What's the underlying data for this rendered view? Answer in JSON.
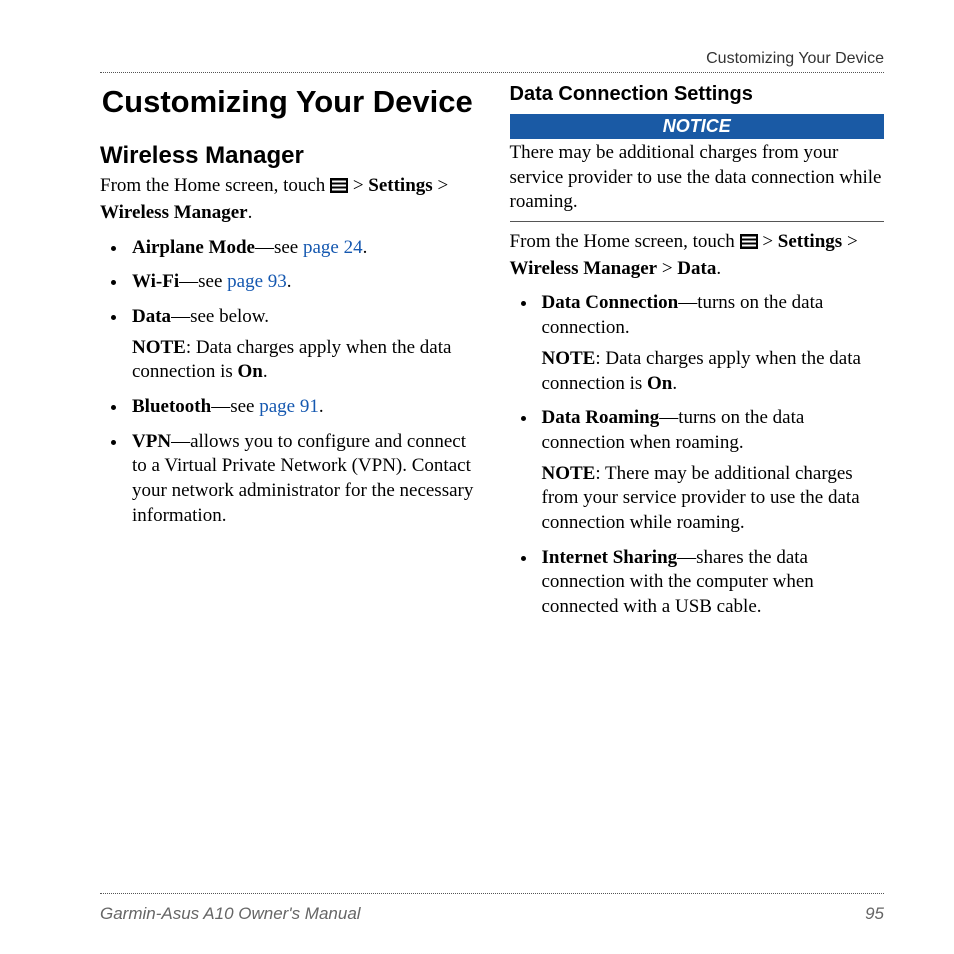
{
  "runningHeader": "Customizing Your Device",
  "chapterTitle": "Customizing Your Device",
  "left": {
    "heading": "Wireless Manager",
    "intro_pre": "From the Home screen, touch ",
    "intro_post": " > ",
    "intro_settings": "Settings",
    "intro_gt": " > ",
    "intro_wm": "Wireless Manager",
    "intro_period": ".",
    "items": [
      {
        "bold": "Airplane Mode",
        "dash": "—see ",
        "link": "page 24",
        "after": "."
      },
      {
        "bold": "Wi-Fi",
        "dash": "—see ",
        "link": "page 93",
        "after": "."
      },
      {
        "bold": "Data",
        "dash": "—see below.",
        "note_label": "NOTE",
        "note_body": ": Data charges apply when the data connection is ",
        "note_bold": "On",
        "note_after": "."
      },
      {
        "bold": "Bluetooth",
        "dash": "—see ",
        "link": "page 91",
        "after": "."
      },
      {
        "bold": "VPN",
        "dash": "—allows you to configure and connect to a Virtual Private Network (VPN). Contact your network administrator for the necessary information."
      }
    ]
  },
  "right": {
    "heading": "Data Connection Settings",
    "notice_label": "NOTICE",
    "notice_body": "There may be additional charges from your service provider to use the data connection while roaming.",
    "intro_pre": "From the Home screen, touch ",
    "intro_post": " > ",
    "intro_settings": "Settings",
    "intro_gt1": " > ",
    "intro_wm": "Wireless Manager",
    "intro_gt2": " > ",
    "intro_data": "Data",
    "intro_period": ".",
    "items": [
      {
        "bold": "Data Connection",
        "dash": "—turns on the data connection.",
        "note_label": "NOTE",
        "note_body": ": Data charges apply when the data connection is ",
        "note_bold": "On",
        "note_after": "."
      },
      {
        "bold": "Data Roaming",
        "dash": "—turns on the data connection when roaming.",
        "note_label": "NOTE",
        "note_body": ": There may be additional charges from your service provider to use the data connection while roaming."
      },
      {
        "bold": "Internet Sharing",
        "dash": "—shares the data connection with the computer when connected with a USB cable."
      }
    ]
  },
  "footer": {
    "left": "Garmin-Asus A10 Owner's Manual",
    "right": "95"
  }
}
